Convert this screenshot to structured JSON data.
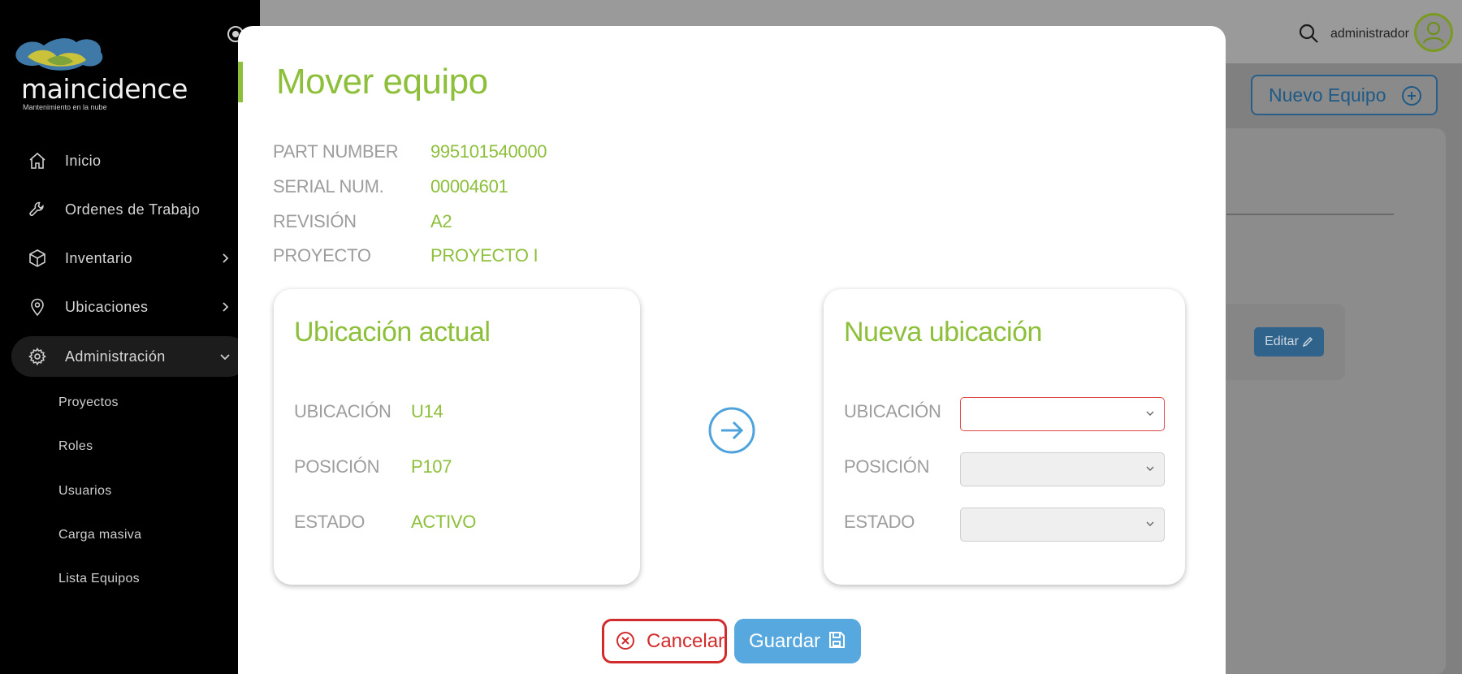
{
  "app": {
    "brand": "maincidence",
    "tagline": "Mantenimiento en la nube"
  },
  "sidebar": {
    "items": [
      {
        "label": "Inicio",
        "icon": "home-icon"
      },
      {
        "label": "Ordenes de Trabajo",
        "icon": "wrench-icon"
      },
      {
        "label": "Inventario",
        "icon": "box-icon",
        "has_submenu": true
      },
      {
        "label": "Ubicaciones",
        "icon": "map-pin-icon",
        "has_submenu": true
      },
      {
        "label": "Administración",
        "icon": "gear-icon",
        "has_submenu": true,
        "expanded": true,
        "active": true
      }
    ],
    "sub_items": [
      "Proyectos",
      "Roles",
      "Usuarios",
      "Carga masiva",
      "Lista Equipos"
    ]
  },
  "header": {
    "user_name": "administrador"
  },
  "background_page": {
    "new_button_label": "Nuevo Equipo",
    "edit_button_label": "Editar"
  },
  "modal": {
    "title": "Mover equipo",
    "info": [
      {
        "label": "PART NUMBER",
        "value": "995101540000"
      },
      {
        "label": "SERIAL NUM.",
        "value": "00004601"
      },
      {
        "label": "REVISIÓN",
        "value": "A2"
      },
      {
        "label": "PROYECTO",
        "value": "PROYECTO I"
      }
    ],
    "current_location": {
      "title": "Ubicación actual",
      "fields": [
        {
          "label": "UBICACIÓN",
          "value": "U14"
        },
        {
          "label": "POSICIÓN",
          "value": "P107"
        },
        {
          "label": "ESTADO",
          "value": "ACTIVO"
        }
      ]
    },
    "new_location": {
      "title": "Nueva ubicación",
      "fields": [
        {
          "label": "UBICACIÓN",
          "value": "",
          "invalid": true
        },
        {
          "label": "POSICIÓN",
          "value": "",
          "disabled": true
        },
        {
          "label": "ESTADO",
          "value": "",
          "disabled": true
        }
      ]
    },
    "cancel_label": "Cancelar",
    "save_label": "Guardar"
  },
  "colors": {
    "accent_green": "#8dbf3a",
    "primary_blue": "#56a8de",
    "danger_red": "#d12b2b",
    "sidebar_bg": "#000000"
  }
}
